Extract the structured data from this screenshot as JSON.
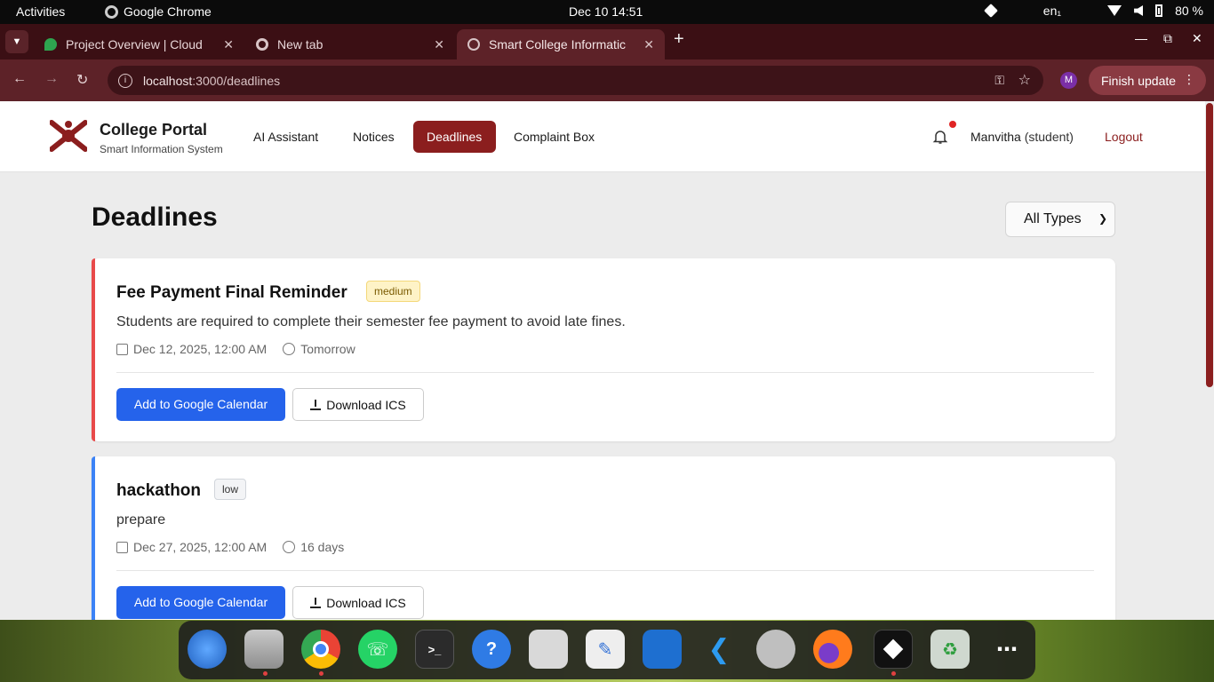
{
  "system_bar": {
    "activities": "Activities",
    "app_name": "Google Chrome",
    "clock": "Dec 10  14:51",
    "lang": "en₁",
    "battery": "80 %"
  },
  "browser": {
    "tabs": [
      {
        "title": "Project Overview | Cloud"
      },
      {
        "title": "New tab"
      },
      {
        "title": "Smart College Informatic"
      }
    ],
    "url_host": "localhost",
    "url_rest": ":3000/deadlines",
    "profile_initial": "M",
    "finish_update": "Finish update"
  },
  "app": {
    "brand_title": "College Portal",
    "brand_subtitle": "Smart Information System",
    "nav": [
      "AI Assistant",
      "Notices",
      "Deadlines",
      "Complaint Box"
    ],
    "user_name": "Manvitha",
    "user_role": "(student)",
    "logout": "Logout",
    "page_title": "Deadlines",
    "filter_value": "All Types",
    "accent_color": "#8b1e1e"
  },
  "deadlines": [
    {
      "title": "Fee Payment Final Reminder",
      "priority": "medium",
      "description": "Students are required to complete their semester fee payment to avoid late fines.",
      "date": "Dec 12, 2025, 12:00 AM",
      "relative": "Tomorrow",
      "accent": "#e84a4a",
      "add_gcal": "Add to Google Calendar",
      "download_ics": "Download ICS"
    },
    {
      "title": "hackathon",
      "priority": "low",
      "description": "prepare",
      "date": "Dec 27, 2025, 12:00 AM",
      "relative": "16 days",
      "accent": "#3b82f6",
      "add_gcal": "Add to Google Calendar",
      "download_ics": "Download ICS"
    }
  ],
  "dock": [
    "thunderbird-icon",
    "files-icon",
    "chrome-icon",
    "whatsapp-icon",
    "terminal-icon",
    "help-icon",
    "screenshot-icon",
    "text-editor-icon",
    "writer-icon",
    "vscode-icon",
    "settings-icon",
    "firefox-icon",
    "app-cube-icon",
    "trash-icon",
    "app-grid-icon"
  ]
}
